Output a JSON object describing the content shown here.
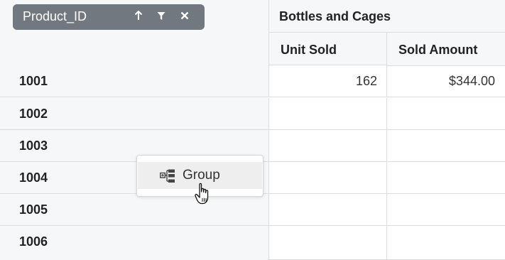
{
  "pivot": {
    "row_field_chip": {
      "label": "Product_ID",
      "icons": [
        "sort-ascending-icon",
        "filter-icon",
        "remove-icon"
      ]
    },
    "column_group_header": "Bottles and Cages",
    "value_headers": [
      "Unit Sold",
      "Sold Amount"
    ],
    "rows": [
      {
        "id": "1001",
        "unit_sold": "162",
        "sold_amount": "$344.00"
      },
      {
        "id": "1002",
        "unit_sold": "",
        "sold_amount": ""
      },
      {
        "id": "1003",
        "unit_sold": "",
        "sold_amount": ""
      },
      {
        "id": "1004",
        "unit_sold": "",
        "sold_amount": ""
      },
      {
        "id": "1005",
        "unit_sold": "",
        "sold_amount": ""
      },
      {
        "id": "1006",
        "unit_sold": "",
        "sold_amount": ""
      }
    ]
  },
  "context_menu": {
    "items": [
      {
        "label": "Group",
        "icon": "group-icon"
      }
    ]
  },
  "colors": {
    "chip_bg": "#717880",
    "header_bg": "#f6f7f8",
    "border": "#dcdcdc",
    "menu_hover_bg": "#eeeeee"
  }
}
